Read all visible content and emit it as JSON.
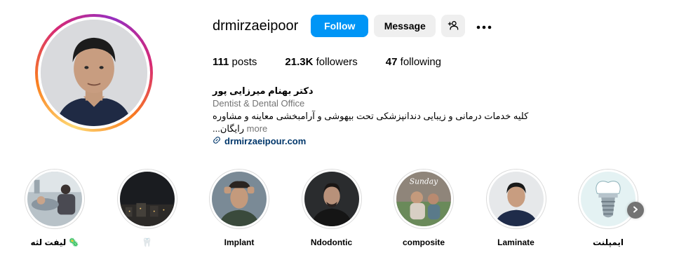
{
  "profile": {
    "username": "drmirzaeipoor",
    "follow_label": "Follow",
    "message_label": "Message",
    "suggest_icon": "add-person-icon",
    "more_icon": "more-dots-icon"
  },
  "stats": {
    "posts_count": "111",
    "posts_label": "posts",
    "followers_count": "21.3K",
    "followers_label": "followers",
    "following_count": "47",
    "following_label": "following"
  },
  "bio": {
    "name": "دکتر بهنام میرزایی پور",
    "category": "Dentist & Dental Office",
    "text": "کلیه خدمات درمانی و زیبایی دندانپزشکی تحت بیهوشی و آرامبخشی معاینه و مشاوره رایگان...",
    "more_label": "more",
    "link": "drmirzaeipour.com",
    "link_icon": "link-icon"
  },
  "highlights": [
    {
      "label": "لیفت لثه 🦠",
      "icon": "dental-clinic-photo"
    },
    {
      "label": "🦷",
      "icon": "night-city-photo"
    },
    {
      "label": "Implant",
      "icon": "man-portrait-photo"
    },
    {
      "label": "Ndodontic",
      "icon": "man-portrait-photo"
    },
    {
      "label": "composite",
      "icon": "sunday-photo"
    },
    {
      "label": "Laminate",
      "icon": "doctor-portrait-photo"
    },
    {
      "label": "ایمپلنت",
      "icon": "implant-tooth-icon"
    }
  ],
  "colors": {
    "follow_button": "#0095f6",
    "secondary_button": "#efefef",
    "link": "#00376b",
    "muted_text": "#737373"
  }
}
